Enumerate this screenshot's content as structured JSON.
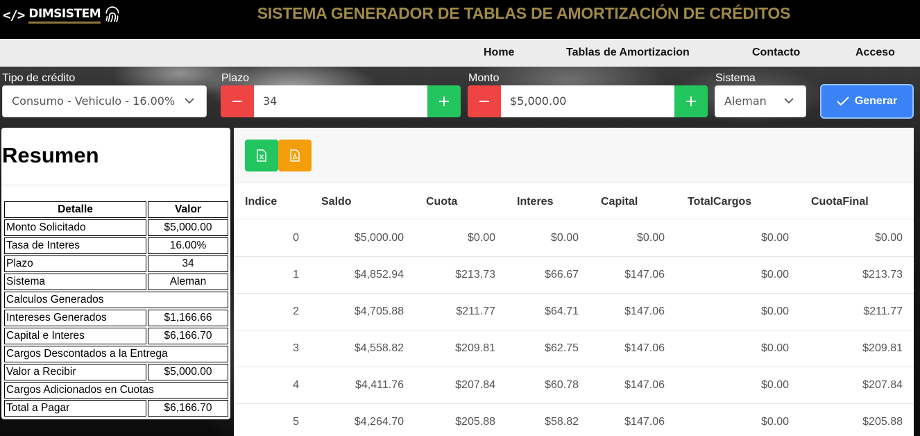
{
  "header": {
    "logo_code": "</>",
    "logo_text": "DIMSISTEM",
    "title": "SISTEMA GENERADOR DE TABLAS DE AMORTIZACIÓN DE CRÉDITOS"
  },
  "nav": {
    "items": [
      "Home",
      "Tablas de Amortizacion",
      "Contacto",
      "Acceso"
    ]
  },
  "form": {
    "credit_type": {
      "label": "Tipo de crédito",
      "value": "Consumo - Vehiculo - 16.00%"
    },
    "term": {
      "label": "Plazo",
      "value": "34"
    },
    "amount": {
      "label": "Monto",
      "value": "$5,000.00"
    },
    "system": {
      "label": "Sistema",
      "value": "Aleman"
    },
    "generate_label": "Generar"
  },
  "summary": {
    "title": "Resumen",
    "headers": [
      "Detalle",
      "Valor"
    ],
    "rows": [
      {
        "label": "Monto Solicitado",
        "value": "$5,000.00"
      },
      {
        "label": "Tasa de Interes",
        "value": "16.00%"
      },
      {
        "label": "Plazo",
        "value": "34"
      },
      {
        "label": "Sistema",
        "value": "Aleman"
      },
      {
        "label": "Calculos Generados",
        "value": null
      },
      {
        "label": "Intereses Generados",
        "value": "$1,166.66"
      },
      {
        "label": "Capital e Interes",
        "value": "$6,166.70"
      },
      {
        "label": "Cargos Descontados a la Entrega",
        "value": null
      },
      {
        "label": "Valor a Recibir",
        "value": "$5,000.00"
      },
      {
        "label": "Cargos Adicionados en Cuotas",
        "value": null
      },
      {
        "label": "Total a Pagar",
        "value": "$6,166.70"
      }
    ]
  },
  "amortization": {
    "columns": [
      "Indice",
      "Saldo",
      "Cuota",
      "Interes",
      "Capital",
      "TotalCargos",
      "CuotaFinal"
    ],
    "rows": [
      [
        "0",
        "$5,000.00",
        "$0.00",
        "$0.00",
        "$0.00",
        "$0.00",
        "$0.00"
      ],
      [
        "1",
        "$4,852.94",
        "$213.73",
        "$66.67",
        "$147.06",
        "$0.00",
        "$213.73"
      ],
      [
        "2",
        "$4,705.88",
        "$211.77",
        "$64.71",
        "$147.06",
        "$0.00",
        "$211.77"
      ],
      [
        "3",
        "$4,558.82",
        "$209.81",
        "$62.75",
        "$147.06",
        "$0.00",
        "$209.81"
      ],
      [
        "4",
        "$4,411.76",
        "$207.84",
        "$60.78",
        "$147.06",
        "$0.00",
        "$207.84"
      ],
      [
        "5",
        "$4,264.70",
        "$205.88",
        "$58.82",
        "$147.06",
        "$0.00",
        "$205.88"
      ]
    ]
  },
  "colors": {
    "title_gold": "#a08a46",
    "minus_red": "#ef4444",
    "plus_green": "#22c55e",
    "generate_blue": "#3b82f6",
    "excel_green": "#22c55e",
    "pdf_orange": "#f59e0b"
  },
  "icons": [
    "fingerprint-icon",
    "chevron-down-icon",
    "minus-icon",
    "plus-icon",
    "check-icon",
    "excel-file-icon",
    "pdf-file-icon"
  ]
}
